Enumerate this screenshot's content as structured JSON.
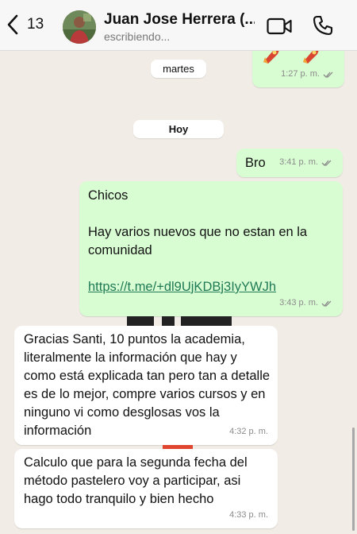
{
  "header": {
    "back_count": "13",
    "contact_name": "Juan Jose Herrera (...",
    "status": "escribiendo..."
  },
  "days": {
    "previous": "martes",
    "today": "Hoy"
  },
  "messages": [
    {
      "direction": "out",
      "time": "1:27 p. m.",
      "read": true
    },
    {
      "direction": "out",
      "text": "Bro",
      "time": "3:41 p. m.",
      "read": true
    },
    {
      "direction": "out",
      "line1": "Chicos",
      "line2": "Hay varios nuevos que no estan en la comunidad",
      "link": "https://t.me/+dl9UjKDBj3IyYWJh",
      "time": "3:43 p. m.",
      "read": true
    },
    {
      "direction": "in",
      "text": "Gracias Santi, 10 puntos la academia, literalmente la información que hay y como está explicada tan pero tan a detalle es de lo mejor, compre varios cursos y en ninguno vi como desglosas vos la información",
      "time": "4:32 p. m."
    },
    {
      "direction": "in",
      "text": "Calculo que para la segunda fecha del método pastelero voy a participar, asi hago todo tranquilo y bien hecho",
      "time": "4:33 p. m."
    }
  ],
  "colors": {
    "outgoing_bubble": "#d9fdd3",
    "incoming_bubble": "#ffffff",
    "link": "#1f7a55",
    "background": "#f1ede6"
  }
}
